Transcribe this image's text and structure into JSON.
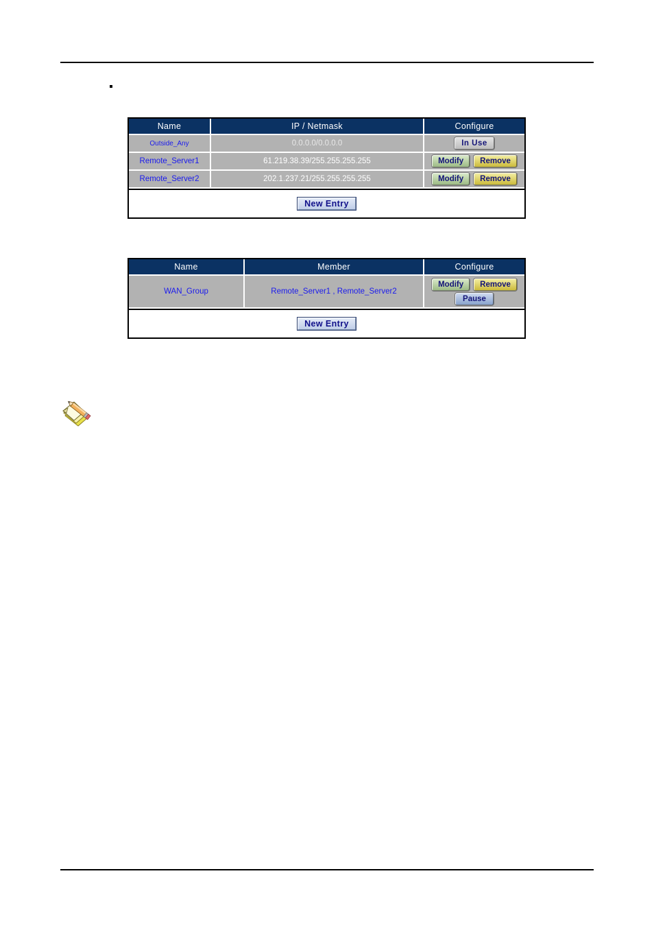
{
  "page": {
    "bullet_text": "",
    "note_icon_name": "note-pencil-icon"
  },
  "address_table": {
    "name": "address-table",
    "columns": [
      "Name",
      "IP / Netmask",
      "Configure"
    ],
    "rows": [
      {
        "name": "Outside_Any",
        "ip_netmask": "0.0.0.0/0.0.0.0",
        "buttons": [
          "In  Use"
        ]
      },
      {
        "name": "Remote_Server1",
        "ip_netmask": "61.219.38.39/255.255.255.255",
        "buttons": [
          "Modify",
          "Remove"
        ]
      },
      {
        "name": "Remote_Server2",
        "ip_netmask": "202.1.237.21/255.255.255.255",
        "buttons": [
          "Modify",
          "Remove"
        ]
      }
    ],
    "new_entry_label": "New Entry"
  },
  "group_table": {
    "name": "address-group-table",
    "columns": [
      "Name",
      "Member",
      "Configure"
    ],
    "rows": [
      {
        "name": "WAN_Group",
        "member": "Remote_Server1 , Remote_Server2",
        "buttons": [
          "Modify",
          "Remove",
          "Pause"
        ]
      }
    ],
    "new_entry_label": "New Entry"
  },
  "colors": {
    "header_bg": "#0b3263",
    "row_bg": "#b2b2b2",
    "link": "#1a1aee",
    "modify": "#9dbb86",
    "remove": "#ccbb3c",
    "pause": "#8aa4cd",
    "inuse": "#bdbdbd",
    "new_entry": "#bfcde8"
  }
}
